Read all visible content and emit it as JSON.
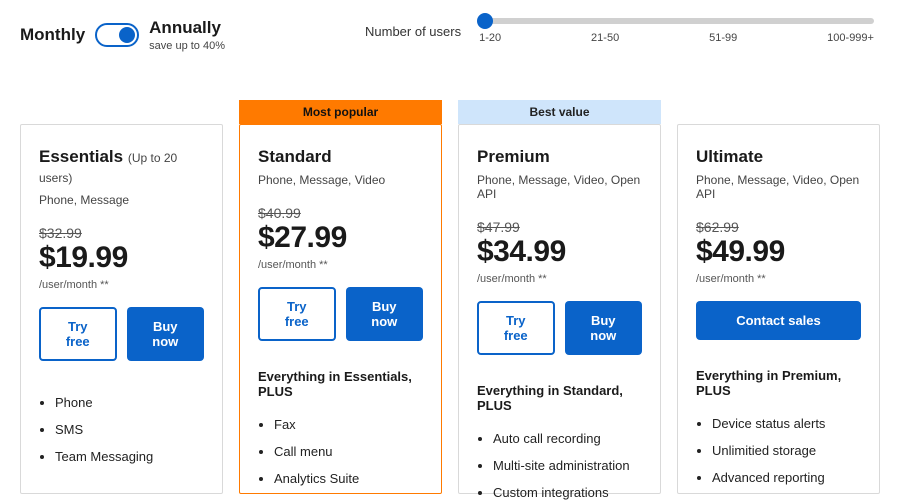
{
  "billing": {
    "monthly_label": "Monthly",
    "annually_label": "Annually",
    "save_note": "save up to 40%"
  },
  "users": {
    "label": "Number of users",
    "ticks": [
      "1-20",
      "21-50",
      "51-99",
      "100-999+"
    ]
  },
  "badges": {
    "most_popular": "Most popular",
    "best_value": "Best value"
  },
  "common": {
    "per": "/user/month **",
    "try_free": "Try free",
    "buy_now": "Buy now",
    "contact_sales": "Contact sales"
  },
  "plans": {
    "essentials": {
      "title": "Essentials",
      "subtitle": "(Up to 20 users)",
      "desc": "Phone, Message",
      "original_price": "$32.99",
      "price": "$19.99",
      "features": [
        "Phone",
        "SMS",
        "Team Messaging"
      ]
    },
    "standard": {
      "title": "Standard",
      "desc": "Phone, Message, Video",
      "original_price": "$40.99",
      "price": "$27.99",
      "plus": "Everything in Essentials, PLUS",
      "features": [
        "Fax",
        "Call menu",
        "Analytics Suite"
      ]
    },
    "premium": {
      "title": "Premium",
      "desc": "Phone, Message, Video, Open API",
      "original_price": "$47.99",
      "price": "$34.99",
      "plus": "Everything in Standard, PLUS",
      "features": [
        "Auto call recording",
        "Multi-site administration",
        "Custom integrations"
      ]
    },
    "ultimate": {
      "title": "Ultimate",
      "desc": "Phone, Message, Video, Open API",
      "original_price": "$62.99",
      "price": "$49.99",
      "plus": "Everything in Premium, PLUS",
      "features": [
        "Device status alerts",
        "Unlimitied storage",
        "Advanced reporting"
      ]
    }
  }
}
